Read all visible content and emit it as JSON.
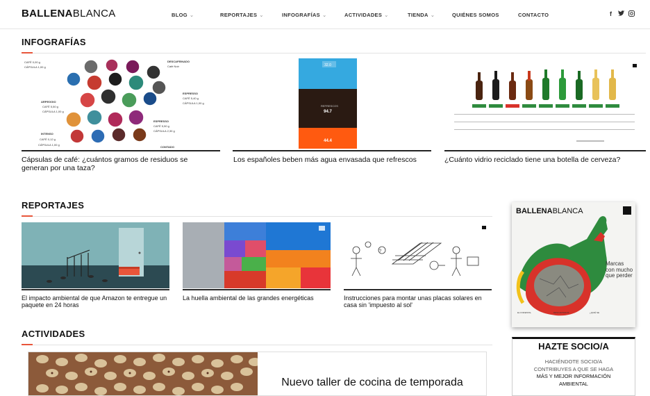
{
  "header": {
    "logo_bold": "BALLENA",
    "logo_light": "BLANCA",
    "menu": [
      {
        "label": "BLOG",
        "caret": "⌄"
      },
      {
        "label": "REPORTAJES",
        "caret": "⌄"
      },
      {
        "label": "INFOGRAFÍAS",
        "caret": "⌄"
      },
      {
        "label": "ACTIVIDADES",
        "caret": "⌄"
      },
      {
        "label": "TIENDA",
        "caret": "⌄"
      },
      {
        "label": "QUIÉNES SOMOS",
        "caret": ""
      },
      {
        "label": "CONTACTO",
        "caret": ""
      }
    ],
    "social": [
      "f",
      "twitter",
      "instagram"
    ]
  },
  "infografias": {
    "heading": "INFOGRAFÍAS",
    "items": [
      {
        "title": "Cápsulas de café: ¿cuántos gramos de residuos se generan por una taza?",
        "labels": {
          "descafeinado": "DESCAFEINADO",
          "espresso": "ESPRESSO",
          "arpeggio": "ARPEGGIO",
          "intenso": "INTENSO",
          "contado": "CONTADO"
        }
      },
      {
        "title": "Los españoles beben más agua envasada que refrescos",
        "values": [
          "32.0",
          "94.7",
          "44.4"
        ]
      },
      {
        "title": "¿Cuánto vidrio reciclado tiene una botella de cerveza?"
      }
    ]
  },
  "reportajes": {
    "heading": "REPORTAJES",
    "items": [
      {
        "title": "El impacto ambiental de que Amazon te entregue un paquete en 24 horas"
      },
      {
        "title": "La huella ambiental de las grandes energéticas"
      },
      {
        "title": "Instrucciones para montar unas placas solares en casa sin 'impuesto al sol'"
      }
    ]
  },
  "magazine": {
    "logo_bold": "BALLENA",
    "logo_light": "BLANCA",
    "headline": "Marcas con mucho que perder"
  },
  "socio": {
    "heading": "HAZTE SOCIO/A",
    "line1": "HACIÉNDOTE SOCIO/A",
    "line2": "CONTRIBUYES A QUE SE HAGA",
    "line3": "MÁS Y MEJOR INFORMACIÓN",
    "line4": "AMBIENTAL"
  },
  "actividades": {
    "heading": "ACTIVIDADES",
    "feature_title": "Nuevo taller de cocina de temporada"
  },
  "colors": {
    "accent": "#e8553a",
    "green": "#2e8b3e",
    "red": "#d8322a",
    "yellow": "#f2c21b"
  }
}
